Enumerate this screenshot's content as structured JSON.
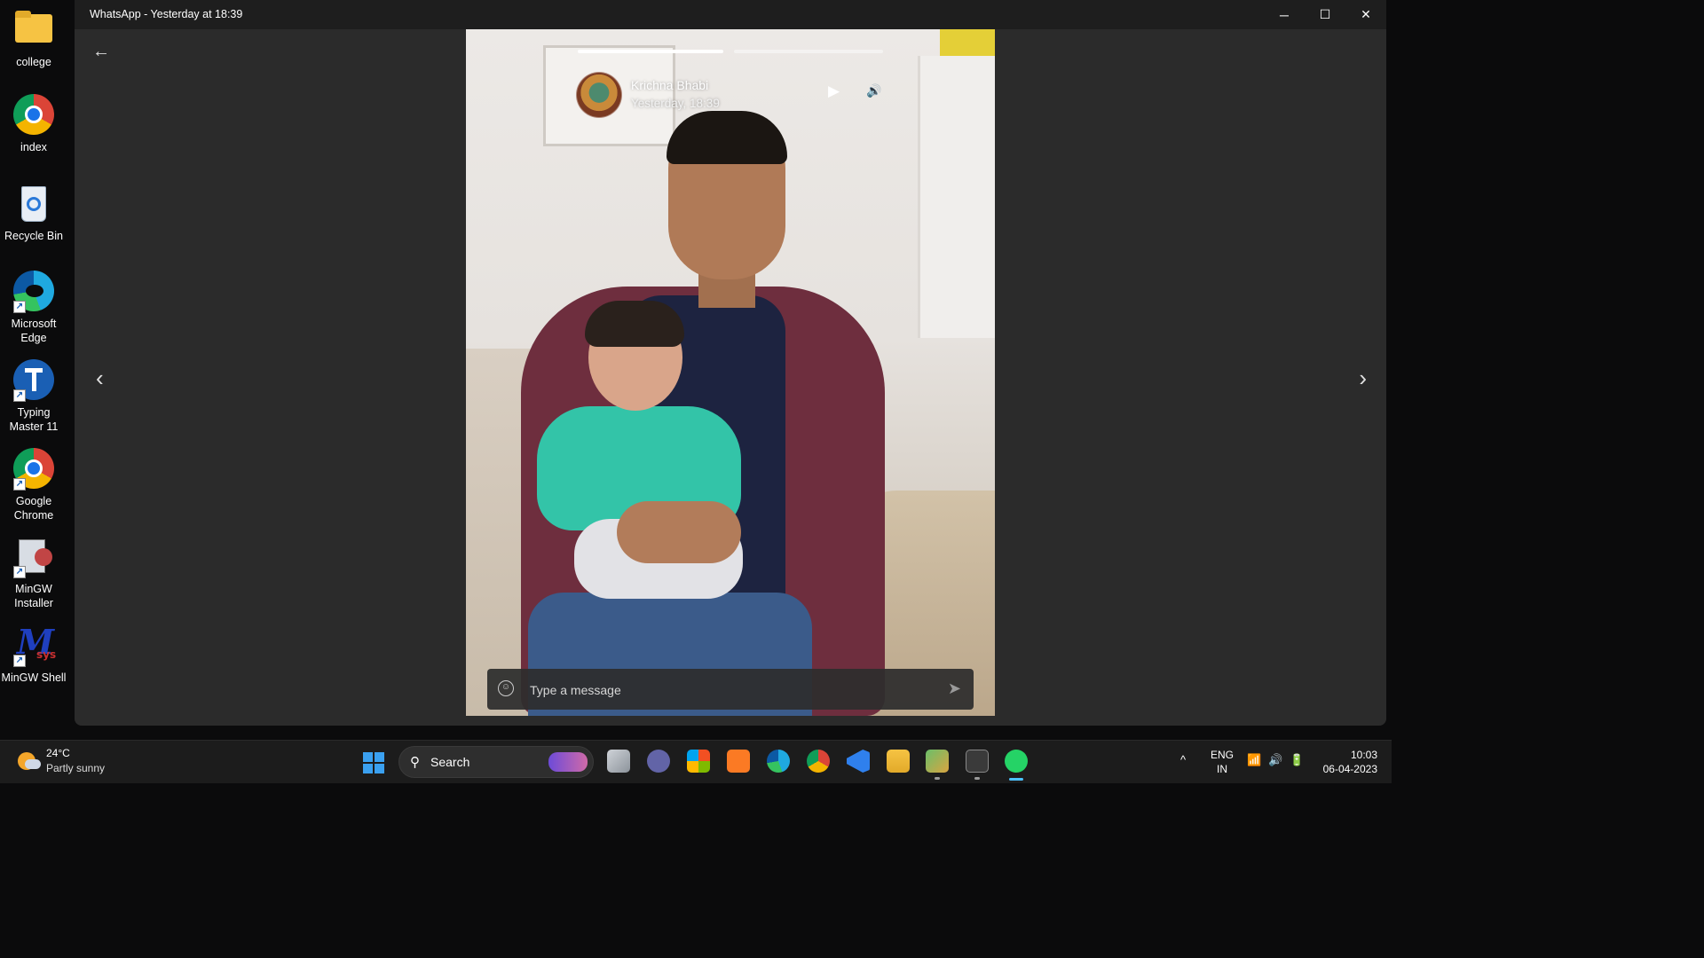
{
  "desktop": {
    "icons": [
      {
        "label": "college",
        "icon": "folder-icon",
        "color": "#f6c343"
      },
      {
        "label": "index",
        "icon": "chrome-icon",
        "color": "#1a73e8"
      },
      {
        "label": "Recycle Bin",
        "icon": "recycle-bin-icon",
        "color": "#2b79d8"
      },
      {
        "label": "Microsoft Edge",
        "icon": "edge-icon",
        "color": "#1fa9e0"
      },
      {
        "label": "Typing Master 11",
        "icon": "typing-master-icon",
        "color": "#1a5fb4"
      },
      {
        "label": "Google Chrome",
        "icon": "chrome-icon",
        "color": "#1a73e8"
      },
      {
        "label": "MinGW Installer",
        "icon": "mingw-installer-icon",
        "color": "#c14545"
      },
      {
        "label": "MinGW Shell",
        "icon": "mingw-shell-icon",
        "color": "#1f3fbf"
      }
    ]
  },
  "window": {
    "title": "WhatsApp - Yesterday at 18:39",
    "minimize": "─",
    "maximize": "☐",
    "close": "✕"
  },
  "viewer": {
    "back": "←",
    "prev": "‹",
    "next": "›",
    "status": {
      "name": "Krichna Bhabi",
      "time": "Yesterday, 18:39",
      "progress_segments": [
        1.0,
        0.0
      ]
    },
    "play": "▶",
    "volume": "🔊",
    "reply": {
      "placeholder": "Type a message",
      "emoji": "☺",
      "send": "➤"
    }
  },
  "taskbar": {
    "weather": {
      "temp": "24°C",
      "desc": "Partly sunny"
    },
    "search_label": "Search",
    "search_icon": "⚲",
    "apps": [
      {
        "name": "task-view-icon",
        "color": "#9aa0a6"
      },
      {
        "name": "teams-chat-icon",
        "color": "#6264a7"
      },
      {
        "name": "microsoft-store-icon",
        "color": "#e8e8e8"
      },
      {
        "name": "xampp-icon",
        "color": "#fb7a24"
      },
      {
        "name": "edge-icon",
        "color": "#1fa9e0"
      },
      {
        "name": "chrome-icon",
        "color": "#1a73e8"
      },
      {
        "name": "vscode-icon",
        "color": "#2f80ed"
      },
      {
        "name": "file-explorer-icon",
        "color": "#f6c343"
      },
      {
        "name": "archive-icon",
        "color": "#d9a441"
      },
      {
        "name": "terminal-icon",
        "color": "#3a3a3a"
      },
      {
        "name": "whatsapp-icon",
        "color": "#25d366"
      }
    ],
    "tray": {
      "chevron": "^",
      "lang_1": "ENG",
      "lang_2": "IN",
      "wifi": "📶",
      "volume": "🔊",
      "battery": "🔋",
      "time": "10:03",
      "date": "06-04-2023"
    }
  }
}
